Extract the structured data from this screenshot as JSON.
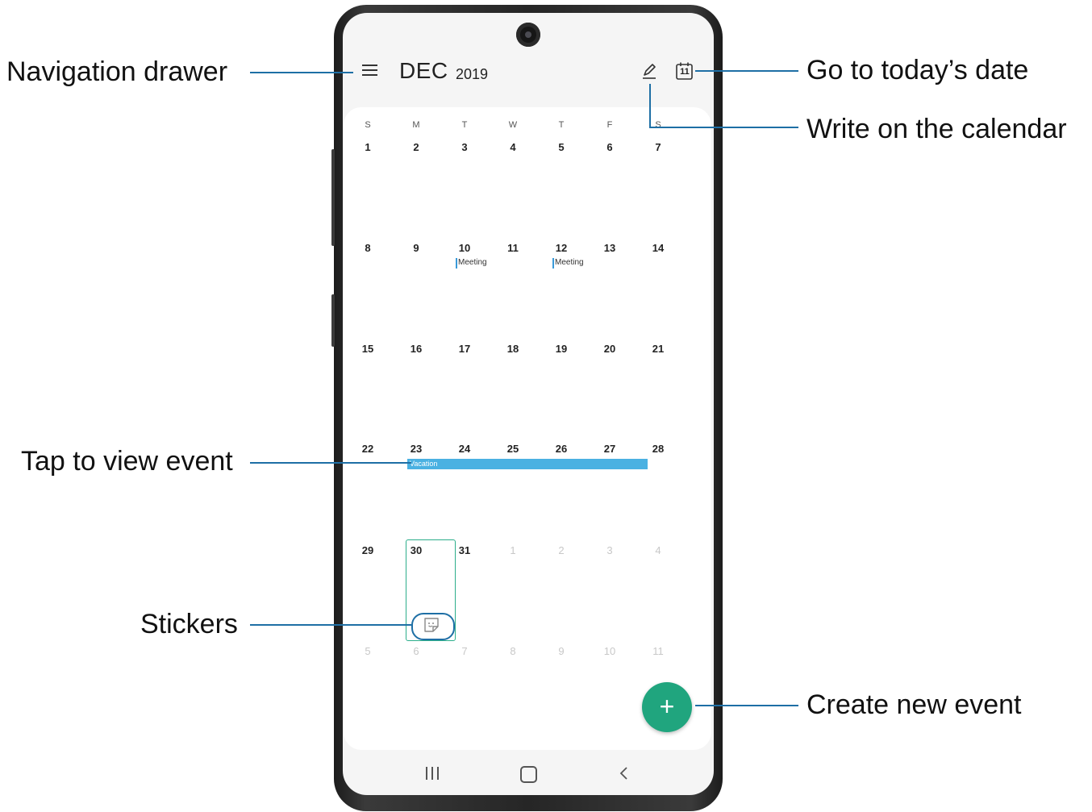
{
  "header": {
    "month": "DEC",
    "year": "2019",
    "today_date": "11"
  },
  "calendar": {
    "weekdays": [
      "S",
      "M",
      "T",
      "W",
      "T",
      "F",
      "S"
    ],
    "weeks": [
      [
        "1",
        "2",
        "3",
        "4",
        "5",
        "6",
        "7"
      ],
      [
        "8",
        "9",
        "10",
        "11",
        "12",
        "13",
        "14"
      ],
      [
        "15",
        "16",
        "17",
        "18",
        "19",
        "20",
        "21"
      ],
      [
        "22",
        "23",
        "24",
        "25",
        "26",
        "27",
        "28"
      ],
      [
        "29",
        "30",
        "31",
        "1",
        "2",
        "3",
        "4"
      ],
      [
        "5",
        "6",
        "7",
        "8",
        "9",
        "10",
        "11"
      ]
    ],
    "events": {
      "meeting_10": "Meeting",
      "meeting_12": "Meeting",
      "vacation": "Vacation"
    }
  },
  "fab": {
    "label": "+"
  },
  "callouts": {
    "navigation_drawer": "Navigation drawer",
    "go_to_today": "Go to today’s date",
    "write_on_calendar": "Write on the calendar",
    "tap_to_view_event": "Tap to view event",
    "stickers": "Stickers",
    "create_new_event": "Create new event"
  },
  "colors": {
    "accent_green": "#20a57e",
    "event_blue": "#4ab1e2",
    "callout_blue": "#1e6fa5",
    "today_outline": "#2cae8b"
  },
  "icons": {
    "menu": "hamburger-icon",
    "pen": "pen-icon",
    "today": "calendar-today-icon",
    "sticker": "sticker-icon",
    "recent": "recent-apps-icon",
    "home": "home-icon",
    "back": "back-icon"
  }
}
